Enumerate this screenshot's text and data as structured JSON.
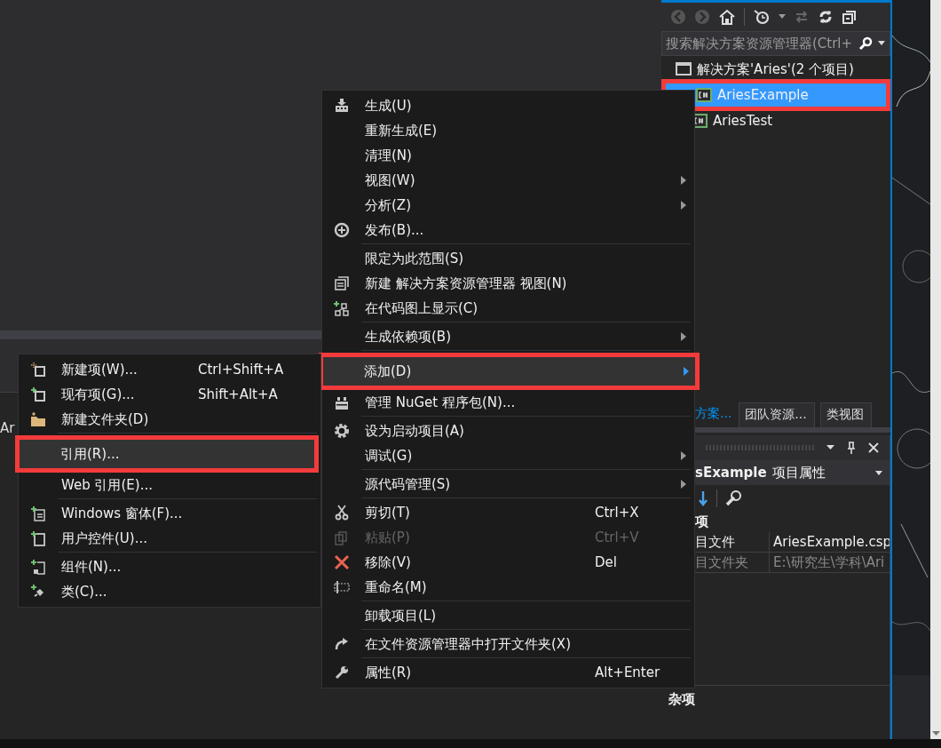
{
  "left_panel": {
    "fragment": "Ar"
  },
  "solution_explorer": {
    "search": {
      "placeholder": "搜索解决方案资源管理器(Ctrl+"
    },
    "tree": [
      {
        "label": "解决方案'Aries'(2 个项目)",
        "selected": false,
        "annotated": false,
        "children": [
          {
            "label": "AriesExample",
            "selected": true,
            "annotated": true
          },
          {
            "label": "AriesTest",
            "selected": false,
            "annotated": false
          }
        ]
      }
    ]
  },
  "tabs": [
    {
      "label": "方案...",
      "selected": true
    },
    {
      "label": "团队资源...",
      "selected": false
    },
    {
      "label": "类视图",
      "selected": false
    }
  ],
  "properties": {
    "object": "sExample",
    "object_type": "项目属性",
    "category": "项",
    "rows": [
      {
        "name": "目文件",
        "value": "AriesExample.csp",
        "disabled": false
      },
      {
        "name": "目文件夹",
        "value": "E:\\研究生\\学科\\Ari",
        "disabled": true
      }
    ],
    "description_title": "杂项"
  },
  "context_menu": [
    {
      "kind": "item",
      "label": "生成(U)",
      "selected": false,
      "disabled": false,
      "submenu": false,
      "annotated": false
    },
    {
      "kind": "item",
      "label": "重新生成(E)",
      "selected": false,
      "disabled": false,
      "submenu": false,
      "annotated": false
    },
    {
      "kind": "item",
      "label": "清理(N)",
      "selected": false,
      "disabled": false,
      "submenu": false,
      "annotated": false
    },
    {
      "kind": "item",
      "label": "视图(W)",
      "selected": false,
      "disabled": false,
      "submenu": true,
      "annotated": false
    },
    {
      "kind": "item",
      "label": "分析(Z)",
      "selected": false,
      "disabled": false,
      "submenu": true,
      "annotated": false
    },
    {
      "kind": "item",
      "label": "发布(B)...",
      "selected": false,
      "disabled": false,
      "submenu": false,
      "annotated": false
    },
    {
      "kind": "separator"
    },
    {
      "kind": "item",
      "label": "限定为此范围(S)",
      "selected": false,
      "disabled": false,
      "submenu": false,
      "annotated": false
    },
    {
      "kind": "item",
      "label": "新建 解决方案资源管理器 视图(N)",
      "selected": false,
      "disabled": false,
      "submenu": false,
      "annotated": false
    },
    {
      "kind": "item",
      "label": "在代码图上显示(C)",
      "selected": false,
      "disabled": false,
      "submenu": false,
      "annotated": false
    },
    {
      "kind": "separator"
    },
    {
      "kind": "item",
      "label": "生成依赖项(B)",
      "selected": false,
      "disabled": false,
      "submenu": true,
      "annotated": false
    },
    {
      "kind": "separator"
    },
    {
      "kind": "item",
      "label": "添加(D)",
      "selected": true,
      "disabled": false,
      "submenu": true,
      "annotated": true
    },
    {
      "kind": "item",
      "label": "管理 NuGet 程序包(N)...",
      "selected": false,
      "disabled": false,
      "submenu": false,
      "annotated": false
    },
    {
      "kind": "separator"
    },
    {
      "kind": "item",
      "label": "设为启动项目(A)",
      "selected": false,
      "disabled": false,
      "submenu": false,
      "annotated": false
    },
    {
      "kind": "item",
      "label": "调试(G)",
      "selected": false,
      "disabled": false,
      "submenu": true,
      "annotated": false
    },
    {
      "kind": "separator"
    },
    {
      "kind": "item",
      "label": "源代码管理(S)",
      "selected": false,
      "disabled": false,
      "submenu": true,
      "annotated": false
    },
    {
      "kind": "separator"
    },
    {
      "kind": "item",
      "label": "剪切(T)",
      "shortcut": "Ctrl+X",
      "selected": false,
      "disabled": false,
      "submenu": false,
      "annotated": false
    },
    {
      "kind": "item",
      "label": "粘贴(P)",
      "shortcut": "Ctrl+V",
      "selected": false,
      "disabled": true,
      "submenu": false,
      "annotated": false
    },
    {
      "kind": "item",
      "label": "移除(V)",
      "shortcut": "Del",
      "selected": false,
      "disabled": false,
      "submenu": false,
      "annotated": false
    },
    {
      "kind": "item",
      "label": "重命名(M)",
      "selected": false,
      "disabled": false,
      "submenu": false,
      "annotated": false
    },
    {
      "kind": "separator"
    },
    {
      "kind": "item",
      "label": "卸载项目(L)",
      "selected": false,
      "disabled": false,
      "submenu": false,
      "annotated": false
    },
    {
      "kind": "separator"
    },
    {
      "kind": "item",
      "label": "在文件资源管理器中打开文件夹(X)",
      "selected": false,
      "disabled": false,
      "submenu": false,
      "annotated": false
    },
    {
      "kind": "separator"
    },
    {
      "kind": "item",
      "label": "属性(R)",
      "shortcut": "Alt+Enter",
      "selected": false,
      "disabled": false,
      "submenu": false,
      "annotated": false
    }
  ],
  "add_submenu": [
    {
      "kind": "item",
      "label": "新建项(W)...",
      "shortcut": "Ctrl+Shift+A",
      "selected": false,
      "annotated": false
    },
    {
      "kind": "item",
      "label": "现有项(G)...",
      "shortcut": "Shift+Alt+A",
      "selected": false,
      "annotated": false
    },
    {
      "kind": "item",
      "label": "新建文件夹(D)",
      "selected": false,
      "annotated": false
    },
    {
      "kind": "separator"
    },
    {
      "kind": "item",
      "label": "引用(R)...",
      "selected": true,
      "annotated": true
    },
    {
      "kind": "item",
      "label": "Web 引用(E)...",
      "selected": false,
      "annotated": false
    },
    {
      "kind": "separator"
    },
    {
      "kind": "item",
      "label": "Windows 窗体(F)...",
      "selected": false,
      "annotated": false
    },
    {
      "kind": "item",
      "label": "用户控件(U)...",
      "selected": false,
      "annotated": false
    },
    {
      "kind": "separator"
    },
    {
      "kind": "item",
      "label": "组件(N)...",
      "selected": false,
      "annotated": false
    },
    {
      "kind": "item",
      "label": "类(C)...",
      "selected": false,
      "annotated": false
    }
  ]
}
